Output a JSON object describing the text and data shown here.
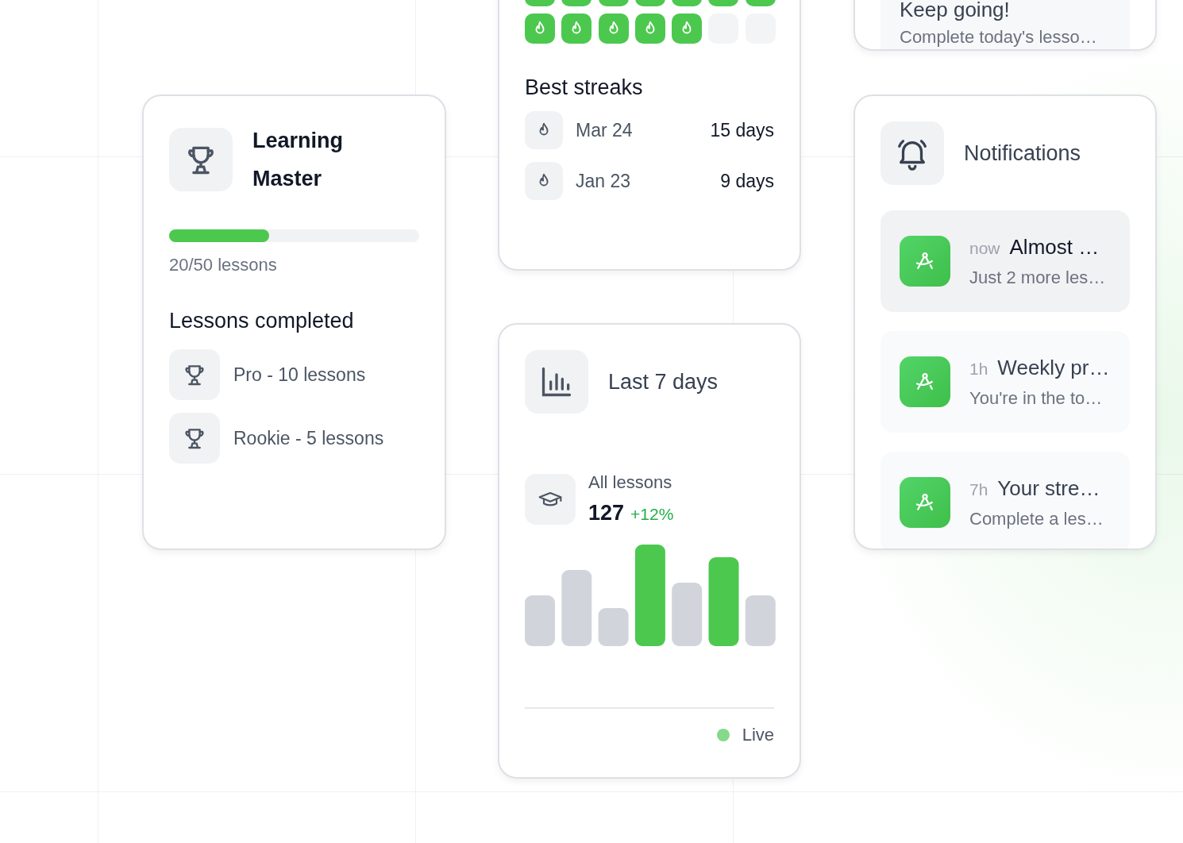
{
  "goal_card": {
    "title": "Keep going!",
    "subtitle": "Complete today's lesso…"
  },
  "streak_card": {
    "days": [
      {
        "done": true
      },
      {
        "done": true
      },
      {
        "done": true
      },
      {
        "done": true
      },
      {
        "done": true
      },
      {
        "done": true
      },
      {
        "done": true
      },
      {
        "done": true
      },
      {
        "done": true
      },
      {
        "done": true
      },
      {
        "done": true
      },
      {
        "done": true
      },
      {
        "done": false
      },
      {
        "done": false
      }
    ],
    "best_title": "Best streaks",
    "best_streaks": [
      {
        "date": "Mar 24",
        "length": "15 days"
      },
      {
        "date": "Jan 23",
        "length": "9 days"
      }
    ]
  },
  "achievement_card": {
    "title": "Learning Master",
    "level": 0.4,
    "progress_text": "20/50 lessons",
    "section_title": "Lessons completed",
    "items": [
      {
        "label": "Pro - 10 lessons"
      },
      {
        "label": "Rookie - 5 lessons"
      }
    ]
  },
  "stats_card": {
    "title": "Last 7 days",
    "metric_label": "All lessons",
    "metric_value": "127",
    "metric_change": "+12%",
    "status": "Live"
  },
  "notifications_card": {
    "title": "Notifications",
    "items": [
      {
        "time": "now",
        "title": "Almost …",
        "body": "Just 2 more les…",
        "selected": true
      },
      {
        "time": "1h",
        "title": "Weekly pr…",
        "body": "You're in the to…",
        "selected": false
      },
      {
        "time": "7h",
        "title": "Your stre…",
        "body": "Complete a les…",
        "selected": false
      }
    ]
  }
}
